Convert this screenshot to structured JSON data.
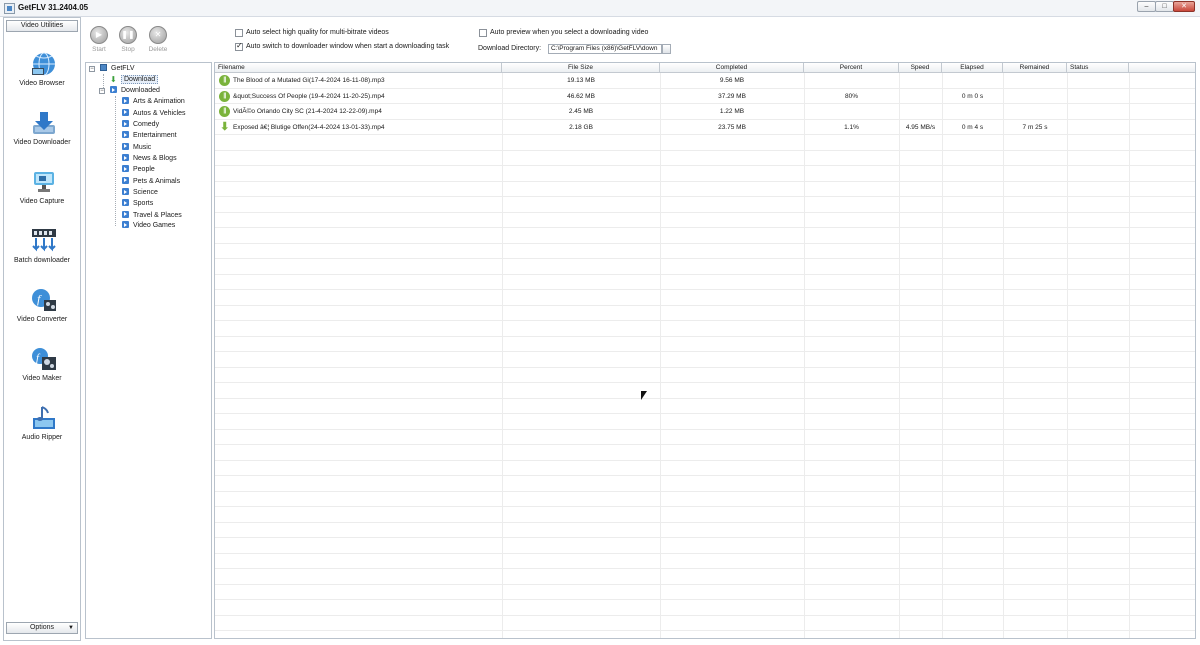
{
  "window": {
    "title": "GetFLV 31.2404.05",
    "min_glyph": "–",
    "max_glyph": "□",
    "close_glyph": "✕"
  },
  "sidebar": {
    "header": "Video Utilities",
    "items": [
      {
        "label": "Video Browser",
        "icon": "globe-icon"
      },
      {
        "label": "Video Downloader",
        "icon": "download-arrow-icon"
      },
      {
        "label": "Video Capture",
        "icon": "camera-icon"
      },
      {
        "label": "Batch downloader",
        "icon": "film-batch-icon"
      },
      {
        "label": "Video Converter",
        "icon": "converter-icon"
      },
      {
        "label": "Video Maker",
        "icon": "film-maker-icon"
      },
      {
        "label": "Audio Ripper",
        "icon": "music-note-icon"
      }
    ],
    "options_label": "Options"
  },
  "toolbar": {
    "start_label": "Start",
    "stop_label": "Stop",
    "delete_label": "Delete",
    "opt_high_quality": {
      "label": "Auto select high quality for multi-bitrate videos",
      "checked": false
    },
    "opt_switch_window": {
      "label": "Auto switch to downloader window when start a downloading task",
      "checked": true
    },
    "opt_auto_preview": {
      "label": "Auto preview when you select a downloading video",
      "checked": false
    },
    "dir_label": "Download Directory:",
    "dir_value": "C:\\Program Files (x86)\\GetFLV\\down"
  },
  "tree": {
    "root": "GetFLV",
    "download": "Download",
    "downloaded": "Downloaded",
    "categories": [
      "Arts & Animation",
      "Autos & Vehicles",
      "Comedy",
      "Entertainment",
      "Music",
      "News & Blogs",
      "People",
      "Pets & Animals",
      "Science",
      "Sports",
      "Travel & Places",
      "Video Games"
    ]
  },
  "grid": {
    "columns": [
      "Filename",
      "File Size",
      "Completed",
      "Percent",
      "Speed",
      "Elapsed",
      "Remained",
      "Status"
    ],
    "rows": [
      {
        "filename": "The Blood of a Mutated Gi(17-4-2024 16-11-08).mp3",
        "size": "19.13 MB",
        "completed": "9.56 MB",
        "percent": "",
        "speed": "",
        "elapsed": "",
        "remained": "",
        "status": "",
        "state": "paused"
      },
      {
        "filename": "&quot;Success Of People (19-4-2024 11-20-25).mp4",
        "size": "46.62 MB",
        "completed": "37.29 MB",
        "percent": "80%",
        "speed": "",
        "elapsed": "0 m 0 s",
        "remained": "",
        "status": "",
        "state": "paused"
      },
      {
        "filename": "VidÃ©o  Orlando City SC (21-4-2024 12-22-09).mp4",
        "size": "2.45 MB",
        "completed": "1.22 MB",
        "percent": "",
        "speed": "",
        "elapsed": "",
        "remained": "",
        "status": "",
        "state": "paused"
      },
      {
        "filename": "Exposed â€¦ Blutige Offen(24-4-2024 13-01-33).mp4",
        "size": "2.18 GB",
        "completed": "23.75 MB",
        "percent": "1.1%",
        "speed": "4.95 MB/s",
        "elapsed": "0 m 4 s",
        "remained": "7 m 25 s",
        "status": "",
        "state": "downloading"
      }
    ]
  }
}
